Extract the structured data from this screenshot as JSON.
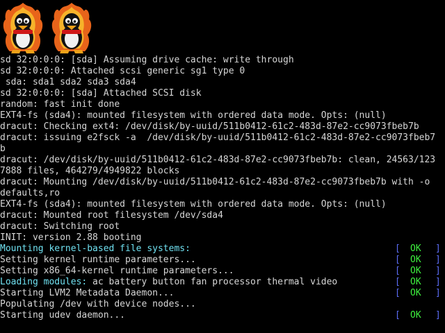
{
  "console": {
    "lines": [
      {
        "text": "sd 32:0:0:0: [sda] Assuming drive cache: write through"
      },
      {
        "text": "sd 32:0:0:0: Attached scsi generic sg1 type 0"
      },
      {
        "text": " sda: sda1 sda2 sda3 sda4"
      },
      {
        "text": "sd 32:0:0:0: [sda] Attached SCSI disk"
      },
      {
        "text": "random: fast init done"
      },
      {
        "text": "EXT4-fs (sda4): mounted filesystem with ordered data mode. Opts: (null)"
      },
      {
        "text": "dracut: Checking ext4: /dev/disk/by-uuid/511b0412-61c2-483d-87e2-cc9073fbeb7b"
      },
      {
        "text": "dracut: issuing e2fsck -a  /dev/disk/by-uuid/511b0412-61c2-483d-87e2-cc9073fbeb7"
      },
      {
        "text": "b"
      },
      {
        "text": "dracut: /dev/disk/by-uuid/511b0412-61c2-483d-87e2-cc9073fbeb7b: clean, 24563/123"
      },
      {
        "text": "7888 files, 464279/4949822 blocks"
      },
      {
        "text": "dracut: Mounting /dev/disk/by-uuid/511b0412-61c2-483d-87e2-cc9073fbeb7b with -o"
      },
      {
        "text": "defaults,ro"
      },
      {
        "text": "EXT4-fs (sda4): mounted filesystem with ordered data mode. Opts: (null)"
      },
      {
        "text": "dracut: Mounted root filesystem /dev/sda4"
      },
      {
        "text": "dracut: Switching root"
      },
      {
        "text": "INIT: version 2.88 booting"
      },
      {
        "highlight": "Mounting kernel-based file systems:",
        "text": "",
        "status": "OK"
      },
      {
        "text": "Setting kernel runtime parameters...",
        "status": "OK"
      },
      {
        "text": "Setting x86_64-kernel runtime parameters...",
        "status": "OK"
      },
      {
        "highlight": "Loading modules:",
        "text": " ac battery button fan processor thermal video",
        "status": "OK"
      },
      {
        "text": "Starting LVM2 Metadata Daemon...",
        "status": "OK"
      },
      {
        "text": "Populating /dev with device nodes..."
      },
      {
        "text": "Starting udev daemon...",
        "status": "OK"
      }
    ]
  },
  "brackets": {
    "left": "[",
    "right": "]"
  },
  "colors": {
    "background": "#000000",
    "text": "#d6d6d6",
    "highlight": "#6fe0f0",
    "ok": "#3ef03e",
    "bracket": "#5b6cf5"
  },
  "logos": {
    "count": 2,
    "icon": "tux-penguin-flame-icon"
  }
}
